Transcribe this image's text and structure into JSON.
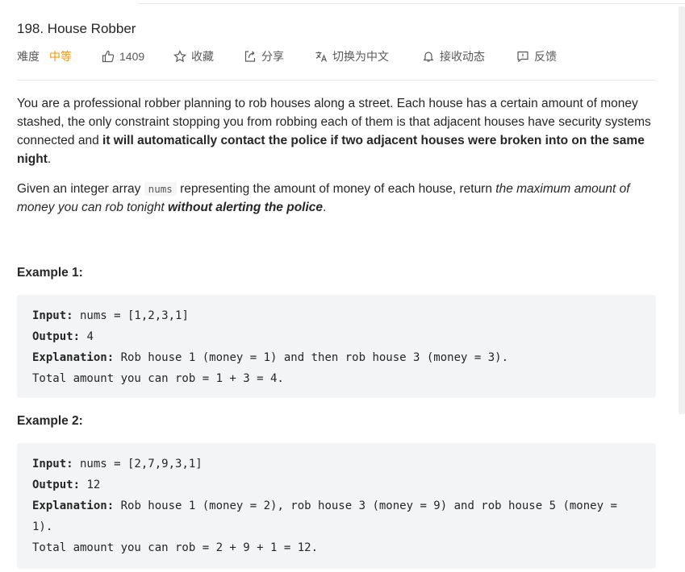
{
  "problem": {
    "title": "198. House Robber",
    "meta": {
      "difficulty_label": "难度",
      "difficulty_value": "中等",
      "likes": "1409",
      "favorite": "收藏",
      "share": "分享",
      "translate": "切换为中文",
      "subscribe": "接收动态",
      "feedback": "反馈"
    },
    "colors": {
      "difficulty": "#ff9500",
      "code_bg": "#f3f4f5"
    },
    "description": {
      "p1_text": "You are a professional robber planning to rob houses along a street. Each house has a certain amount of money stashed, the only constraint stopping you from robbing each of them is that adjacent houses have security systems connected and ",
      "p1_bold": "it will automatically contact the police if two adjacent houses were broken into on the same night",
      "p1_end": ".",
      "p2_start": "Given an integer array ",
      "p2_code": "nums",
      "p2_mid": " representing the amount of money of each house, return ",
      "p2_italic": "the maximum amount of money you can rob tonight ",
      "p2_bold_italic": "without alerting the police",
      "p2_end": "."
    },
    "examples": [
      {
        "title": "Example 1:",
        "input_label": "Input:",
        "input": " nums = [1,2,3,1]",
        "output_label": "Output:",
        "output": " 4",
        "explanation_label": "Explanation:",
        "explanation": " Rob house 1 (money = 1) and then rob house 3 (money = 3).",
        "explanation_cont": "Total amount you can rob = 1 + 3 = 4."
      },
      {
        "title": "Example 2:",
        "input_label": "Input:",
        "input": " nums = [2,7,9,3,1]",
        "output_label": "Output:",
        "output": " 12",
        "explanation_label": "Explanation:",
        "explanation": " Rob house 1 (money = 2), rob house 3 (money = 9) and rob house 5 (money = 1).",
        "explanation_cont": "Total amount you can rob = 2 + 9 + 1 = 12."
      }
    ]
  }
}
